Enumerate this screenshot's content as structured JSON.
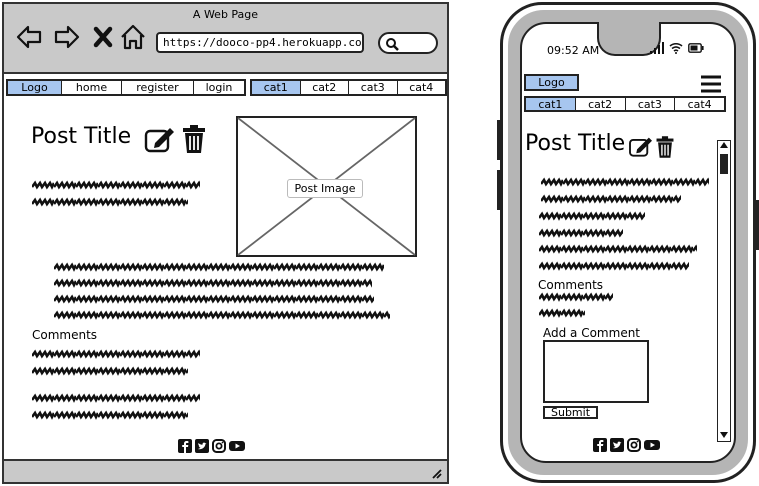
{
  "desktop": {
    "window_title": "A Web Page",
    "url": "https://dooco-pp4.herokuapp.co",
    "nav": {
      "logo": "Logo",
      "links": [
        "home",
        "register",
        "login"
      ],
      "categories": [
        "cat1",
        "cat2",
        "cat3",
        "cat4"
      ]
    },
    "post_title": "Post Title",
    "post_image_label": "Post Image",
    "comments_heading": "Comments"
  },
  "mobile": {
    "status_time": "09:52 AM",
    "nav": {
      "logo": "Logo",
      "categories": [
        "cat1",
        "cat2",
        "cat3",
        "cat4"
      ]
    },
    "post_title": "Post Title",
    "comments_heading": "Comments",
    "add_comment_label": "Add a Comment",
    "submit_label": "Submit"
  },
  "colors": {
    "nav_highlight": "#a7c6ef",
    "chrome_gray": "#c9c9c9",
    "phone_band": "#b5b5b5"
  },
  "icons": [
    "back-arrow-icon",
    "forward-arrow-icon",
    "close-x-icon",
    "home-icon",
    "edit-icon",
    "trash-icon",
    "facebook-icon",
    "twitter-icon",
    "instagram-icon",
    "youtube-icon",
    "hamburger-menu-icon",
    "signal-icon",
    "wifi-icon",
    "battery-icon",
    "resize-grip-icon"
  ]
}
